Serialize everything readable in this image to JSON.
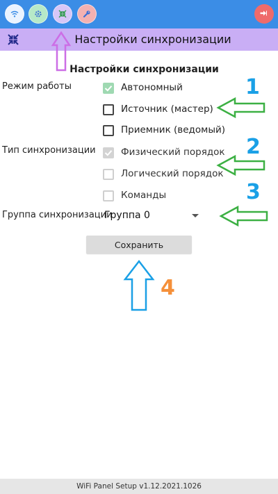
{
  "topbar": {
    "buttons": [
      {
        "icon": "wifi-icon",
        "bg": "#eaf3ff"
      },
      {
        "icon": "gear-icon",
        "bg": "#b7e9c8"
      },
      {
        "icon": "collapse-icon",
        "bg": "#d7c6f7"
      },
      {
        "icon": "wrench-icon",
        "bg": "#f3b1b1"
      }
    ],
    "logout_icon": "logout-icon",
    "logout_bg": "#ef6b6b"
  },
  "subbar": {
    "icon": "collapse-icon",
    "title": "Настройки синхронизации"
  },
  "main": {
    "section_title": "Настройки синхронизации",
    "mode_label": "Режим работы",
    "mode_options": [
      {
        "label": "Автономный",
        "checked": true,
        "enabled": false
      },
      {
        "label": "Источник (мастер)",
        "checked": false,
        "enabled": true
      },
      {
        "label": "Приемник (ведомый)",
        "checked": false,
        "enabled": true
      }
    ],
    "sync_type_label": "Тип синхронизации",
    "sync_type_options": [
      {
        "label": "Физический порядок",
        "checked": true,
        "enabled": false
      },
      {
        "label": "Логический порядок",
        "checked": false,
        "enabled": false
      },
      {
        "label": "Команды",
        "checked": false,
        "enabled": false
      }
    ],
    "group_label": "Группа синхронизации",
    "group_value": "Группа 0",
    "save_label": "Сохранить"
  },
  "annotations": {
    "labels": [
      "1",
      "2",
      "3",
      "4"
    ],
    "colors": {
      "numbers_blue": "#1aa0e6",
      "number_orange": "#f5903a",
      "arrow_green": "#3cb043",
      "arrow_violet": "#cc6ee6",
      "arrow_blue": "#1aa0e6"
    }
  },
  "footer": {
    "version": "WiFi Panel Setup v1.12.2021.1026"
  }
}
